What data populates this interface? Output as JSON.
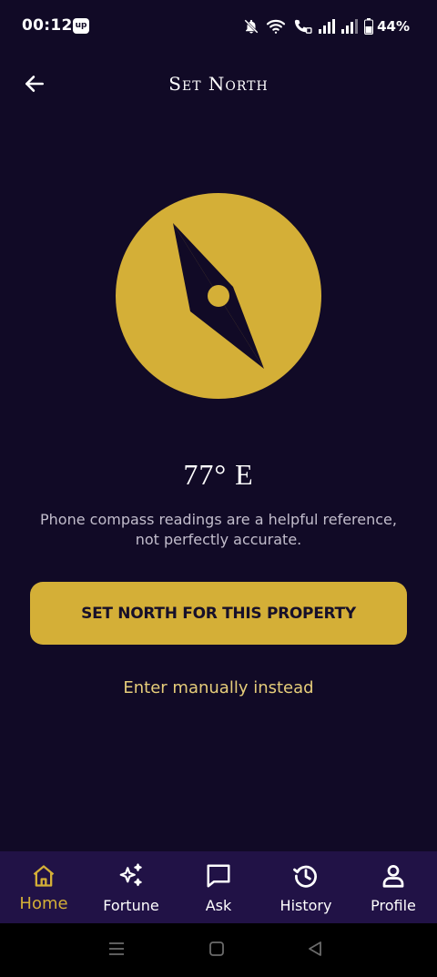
{
  "status_bar": {
    "time": "00:12",
    "app_badge": "up",
    "battery": "44%",
    "icons": [
      "bell-off-icon",
      "wifi-icon",
      "wifi-calling-icon",
      "signal-icon",
      "signal-icon",
      "battery-icon"
    ]
  },
  "header": {
    "title": "Set North",
    "back_icon": "arrow-left-icon"
  },
  "compass": {
    "icon": "compass-icon",
    "heading": "77° E",
    "disclaimer_line1": "Phone compass readings are a helpful reference,",
    "disclaimer_line2": "not perfectly accurate."
  },
  "actions": {
    "primary_label": "SET NORTH FOR THIS PROPERTY",
    "secondary_label": "Enter manually instead"
  },
  "bottom_nav": {
    "items": [
      {
        "label": "Home",
        "icon": "home-icon",
        "active": true
      },
      {
        "label": "Fortune",
        "icon": "sparkles-icon",
        "active": false
      },
      {
        "label": "Ask",
        "icon": "chat-icon",
        "active": false
      },
      {
        "label": "History",
        "icon": "history-icon",
        "active": false
      },
      {
        "label": "Profile",
        "icon": "user-icon",
        "active": false
      }
    ]
  },
  "colors": {
    "background": "#110a26",
    "accent": "#d4af37",
    "nav_background": "#211246",
    "link": "#e6cd7a"
  }
}
